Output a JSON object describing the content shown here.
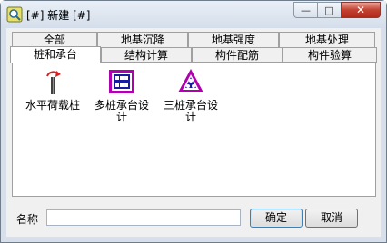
{
  "window": {
    "title": "[#] 新建 [#]",
    "minimize_glyph": "—",
    "maximize_glyph": "□",
    "close_glyph": "✕"
  },
  "tabs": {
    "row_back": [
      "全部",
      "地基沉降",
      "地基强度",
      "地基处理"
    ],
    "row_front": [
      "桩和承台",
      "结构计算",
      "构件配筋",
      "构件验算"
    ],
    "active": "桩和承台"
  },
  "items": [
    {
      "label": "水平荷载桩",
      "icon": "horizontal-load-pile-icon"
    },
    {
      "label": "多桩承台设计",
      "icon": "multi-pile-cap-icon"
    },
    {
      "label": "三桩承台设计",
      "icon": "three-pile-cap-icon"
    }
  ],
  "footer": {
    "name_label": "名称",
    "name_value": "",
    "ok_label": "确定",
    "cancel_label": "取消"
  }
}
